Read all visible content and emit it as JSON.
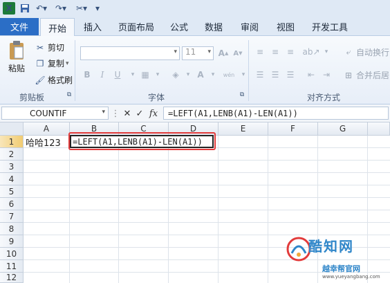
{
  "quick_access": {
    "app_logo": "X",
    "icons": [
      "excel-logo",
      "save-icon",
      "undo-icon",
      "redo-icon",
      "brush-icon",
      "customize-icon"
    ]
  },
  "tabs": {
    "file": "文件",
    "items": [
      "开始",
      "插入",
      "页面布局",
      "公式",
      "数据",
      "审阅",
      "视图",
      "开发工具"
    ],
    "active": "开始"
  },
  "ribbon": {
    "clipboard": {
      "paste": "粘贴",
      "cut": "剪切",
      "copy": "复制",
      "format_painter": "格式刷",
      "group_label": "剪贴板"
    },
    "font": {
      "font_name": "",
      "font_size": "11",
      "grow": "A",
      "shrink": "A",
      "bold": "B",
      "italic": "I",
      "underline": "U",
      "color_a": "A",
      "wen": "wén",
      "group_label": "字体"
    },
    "alignment": {
      "wrap_text": "自动换行",
      "merge_center": "合并后居中",
      "group_label": "对齐方式"
    }
  },
  "formula_bar": {
    "name_box": "COUNTIF",
    "cancel": "✕",
    "enter": "✓",
    "fx": "fx",
    "formula": "=LEFT(A1,LENB(A1)-LEN(A1))"
  },
  "grid": {
    "columns": [
      "A",
      "B",
      "C",
      "D",
      "E",
      "F",
      "G"
    ],
    "rows": [
      "1",
      "2",
      "3",
      "4",
      "5",
      "6",
      "7",
      "8",
      "9",
      "10",
      "11",
      "12"
    ],
    "cells": {
      "A1": "哈哈123",
      "B1": "=LEFT(A1,LENB(A1)-LEN(A1))"
    }
  },
  "watermark": {
    "title": "酷知网",
    "subtitle": "越幸帮官网",
    "url": "www.yueyangbang.com",
    "color": "#2f86c9"
  },
  "colors": {
    "file_tab": "#2b6ec6",
    "highlight": "#e23b3b",
    "header_selected": "#f1cc72"
  }
}
